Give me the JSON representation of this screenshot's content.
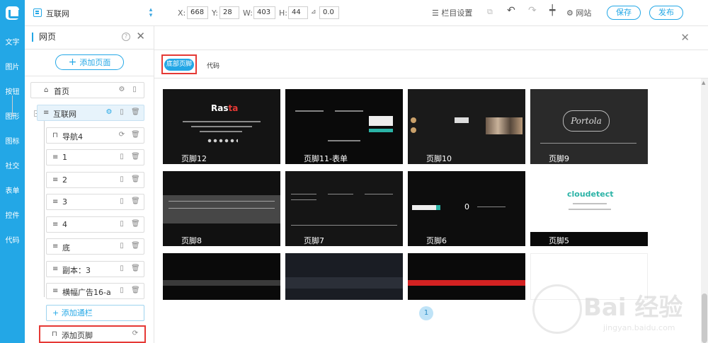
{
  "rail": {
    "items": [
      "文字",
      "图片",
      "按钮",
      "图形",
      "图标",
      "社交",
      "表单",
      "控件",
      "代码"
    ]
  },
  "topbar": {
    "site": "互联网",
    "coords": {
      "x_label": "X:",
      "x": "668",
      "y_label": "Y:",
      "y": "28",
      "w_label": "W:",
      "w": "403",
      "h_label": "H:",
      "h": "44",
      "angle_label": "⊿",
      "angle": "0.0"
    },
    "column_settings": "栏目设置",
    "site_label": "网站",
    "save": "保存",
    "publish": "发布"
  },
  "panel": {
    "title": "网页",
    "add_page": "添加页面",
    "pages": [
      {
        "label": "首页"
      },
      {
        "label": "互联网"
      },
      {
        "label": "导航4"
      },
      {
        "label": "1"
      },
      {
        "label": "2"
      },
      {
        "label": "3"
      },
      {
        "label": "4"
      },
      {
        "label": "底"
      },
      {
        "label": "副本：3"
      },
      {
        "label": "横幅广告16-a"
      }
    ],
    "add_bar": "添加通栏",
    "add_footer": "添加页脚"
  },
  "main": {
    "tabs": [
      "底部页脚",
      "代码"
    ],
    "cards": [
      "页脚12",
      "页脚11-表单",
      "页脚10",
      "页脚9",
      "页脚8",
      "页脚7",
      "页脚6",
      "页脚5",
      "",
      "",
      "",
      ""
    ],
    "page": "1"
  },
  "watermark": {
    "brand": "Bai 经验",
    "url": "jingyan.baidu.com"
  },
  "colors": {
    "accent": "#23a7e6",
    "highlight": "#e53935"
  }
}
